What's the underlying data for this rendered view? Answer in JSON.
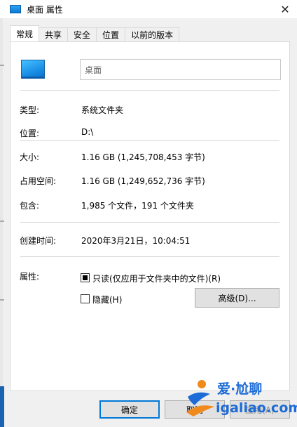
{
  "window": {
    "title": "桌面 属性",
    "close_glyph": "✕"
  },
  "tabs": [
    {
      "label": "常规",
      "active": true
    },
    {
      "label": "共享",
      "active": false
    },
    {
      "label": "安全",
      "active": false
    },
    {
      "label": "位置",
      "active": false
    },
    {
      "label": "以前的版本",
      "active": false
    }
  ],
  "general": {
    "name_value": "桌面",
    "type_label": "类型:",
    "type_value": "系统文件夹",
    "location_label": "位置:",
    "location_value": "D:\\",
    "size_label": "大小:",
    "size_value": "1.16 GB (1,245,708,453 字节)",
    "disk_size_label": "占用空间:",
    "disk_size_value": "1.16 GB (1,249,652,736 字节)",
    "contains_label": "包含:",
    "contains_value": "1,985 个文件，191 个文件夹",
    "created_label": "创建时间:",
    "created_value": "2020年3月21日，10:04:51",
    "attributes_label": "属性:",
    "readonly_label": "只读(仅应用于文件夹中的文件)(R)",
    "readonly_checked": true,
    "hidden_label": "隐藏(H)",
    "hidden_checked": false,
    "advanced_button": "高级(D)..."
  },
  "footer": {
    "ok": "确定",
    "cancel": "取消",
    "apply": "应用(A)"
  },
  "watermark": {
    "brand": "爱·尬聊",
    "url": "igaliao.com"
  },
  "colors": {
    "accent": "#0078d7",
    "folder_blue": "#1a8fe6",
    "watermark_blue": "#1c6bd6",
    "watermark_orange": "#f08a1c"
  }
}
